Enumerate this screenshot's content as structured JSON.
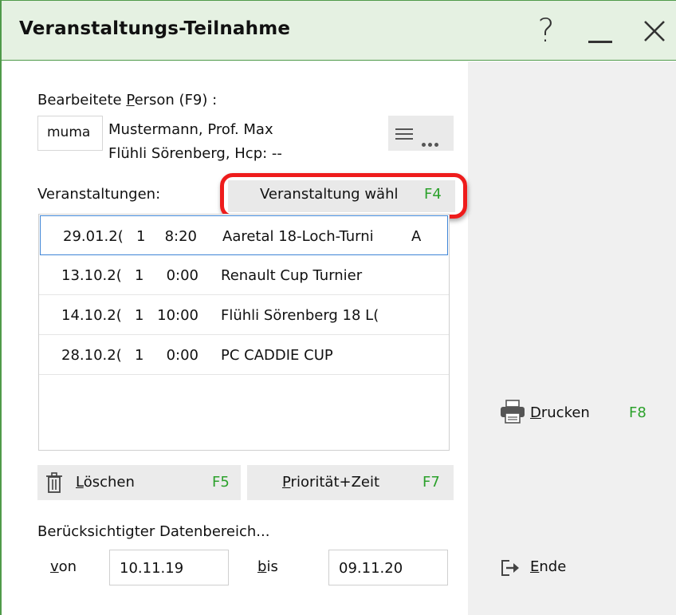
{
  "window": {
    "title": "Veranstaltungs-Teilnahme",
    "help_glyph": "?"
  },
  "person": {
    "label_pre": "Bearbeitete ",
    "label_accel": "P",
    "label_post": "erson (F9) :",
    "code": "muma",
    "name": "Mustermann, Prof. Max",
    "club": "Flühli Sörenberg, Hcp: --"
  },
  "events": {
    "label": "Veranstaltungen:",
    "choose_label": "Veranstaltung wähl",
    "choose_key": "F4",
    "rows": [
      {
        "date": "29.01.2(",
        "round": "1",
        "time": "8:20",
        "name": "Aaretal 18-Loch-Turni",
        "flag": "A"
      },
      {
        "date": "13.10.2(",
        "round": "1",
        "time": "0:00",
        "name": "Renault Cup Turnier",
        "flag": ""
      },
      {
        "date": "14.10.2(",
        "round": "1",
        "time": "10:00",
        "name": "Flühli Sörenberg 18 L(",
        "flag": ""
      },
      {
        "date": "28.10.2(",
        "round": "1",
        "time": "0:00",
        "name": "PC CADDIE CUP",
        "flag": ""
      }
    ]
  },
  "buttons": {
    "delete_accel": "L",
    "delete_rest": "öschen",
    "delete_key": "F5",
    "priority_accel": "P",
    "priority_rest": "riorität+Zeit",
    "priority_key": "F7"
  },
  "range": {
    "label": "Berücksichtigter Datenbereich...",
    "from_accel": "v",
    "from_rest": "on",
    "from_value": "10.11.19",
    "to_accel": "b",
    "to_rest": "is",
    "to_value": "09.11.20"
  },
  "side": {
    "print_accel": "D",
    "print_rest": "rucken",
    "print_key": "F8",
    "end_accel": "E",
    "end_rest": "nde"
  },
  "colors": {
    "accent_green": "#2ba12b",
    "titlebar_bg": "#e5f1e2",
    "highlight_red": "#ee1c1c",
    "selection_blue": "#3f85d6"
  }
}
